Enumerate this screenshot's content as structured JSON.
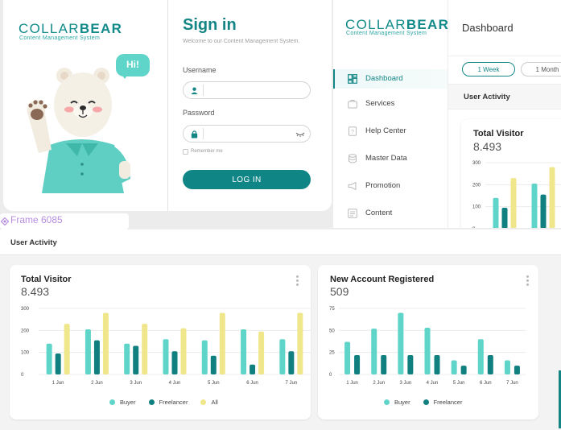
{
  "colors": {
    "buyer": "#5fd4c8",
    "freelancer": "#0f7f7f",
    "all": "#f0e68c",
    "brand": "#138585"
  },
  "brand": {
    "name_light": "COLLAR",
    "name_bold": "BEAR",
    "tagline": "Content Management System"
  },
  "login": {
    "speech_bubble": "Hi!",
    "title": "Sign in",
    "welcome": "Welcome to our Content Management System.",
    "username_label": "Username",
    "password_label": "Password",
    "remember_label": "Remember me",
    "login_button": "LOG IN"
  },
  "sidebar": {
    "items": [
      {
        "label": "Dashboard",
        "icon": "dashboard-icon",
        "active": true
      },
      {
        "label": "Services",
        "icon": "briefcase-icon",
        "active": false
      },
      {
        "label": "Help Center",
        "icon": "help-icon",
        "active": false
      },
      {
        "label": "Master Data",
        "icon": "database-icon",
        "active": false
      },
      {
        "label": "Promotion",
        "icon": "megaphone-icon",
        "active": false
      },
      {
        "label": "Content",
        "icon": "content-icon",
        "active": false
      }
    ]
  },
  "dashboard": {
    "title": "Dashboard",
    "range_tabs": [
      "1 Week",
      "1 Month"
    ],
    "section_title": "User Activity",
    "preview_card_title": "Total Visitor",
    "preview_card_value": "8.493"
  },
  "frame_label": "Frame 6085",
  "bottom": {
    "section_title": "User Activity"
  },
  "chart_data": [
    {
      "type": "bar",
      "title": "Total Visitor",
      "value_text": "8.493",
      "categories": [
        "1 Jun",
        "2 Jun",
        "3 Jun",
        "4 Jun",
        "5 Jun",
        "6 Jun",
        "7 Jun"
      ],
      "ylim": [
        0,
        300
      ],
      "yticks": [
        0,
        100,
        200,
        300
      ],
      "series": [
        {
          "name": "Buyer",
          "values": [
            140,
            205,
            140,
            160,
            155,
            205,
            160
          ]
        },
        {
          "name": "Freelancer",
          "values": [
            95,
            155,
            130,
            105,
            85,
            45,
            105
          ]
        },
        {
          "name": "All",
          "values": [
            230,
            280,
            230,
            210,
            280,
            195,
            280
          ]
        }
      ]
    },
    {
      "type": "bar",
      "title": "New Account Registered",
      "value_text": "509",
      "categories": [
        "1 Jun",
        "2 Jun",
        "3 Jun",
        "4 Jun",
        "5 Jun",
        "6 Jun",
        "7 Jun"
      ],
      "ylim": [
        0,
        75
      ],
      "yticks": [
        0,
        25,
        50,
        75
      ],
      "series": [
        {
          "name": "Buyer",
          "values": [
            37,
            52,
            70,
            53,
            16,
            40,
            16
          ]
        },
        {
          "name": "Freelancer",
          "values": [
            22,
            22,
            22,
            22,
            10,
            22,
            10
          ]
        }
      ]
    }
  ]
}
